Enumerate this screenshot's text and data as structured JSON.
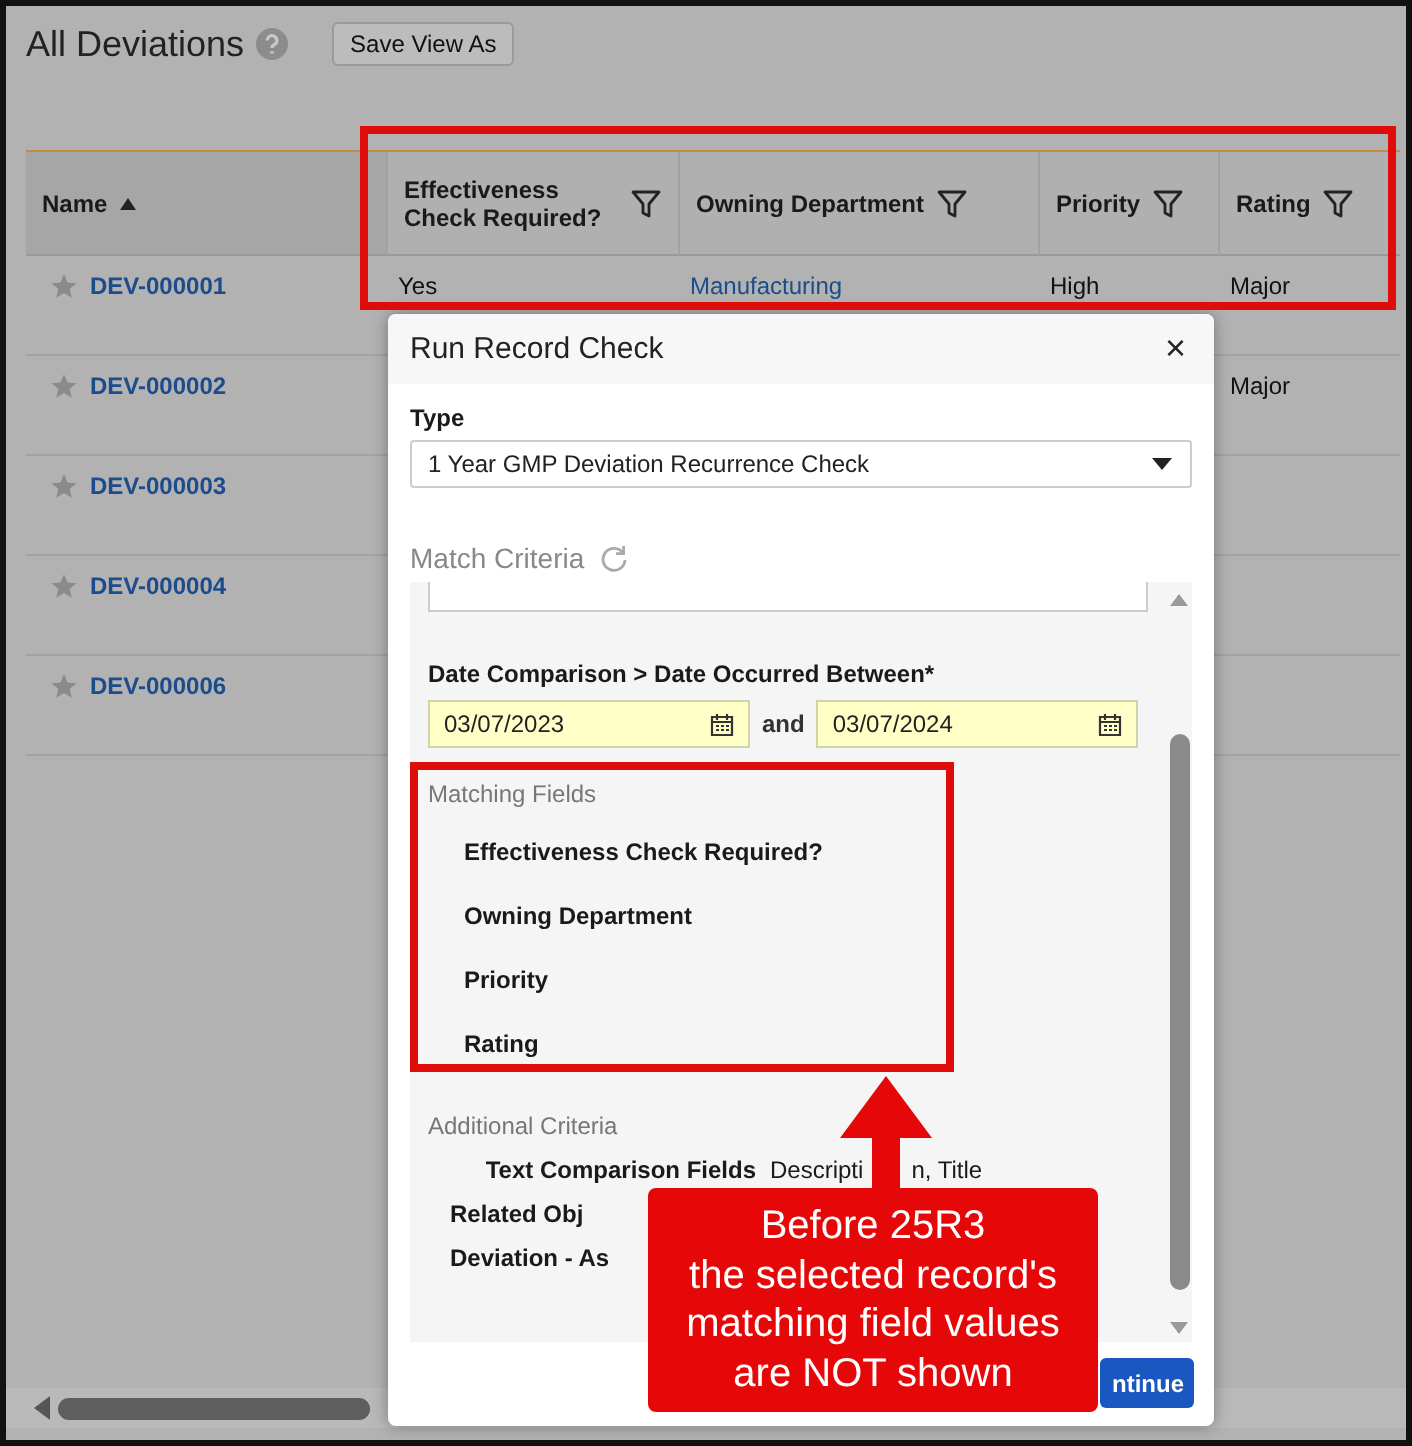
{
  "page": {
    "title": "All Deviations",
    "save_view_button": "Save View As"
  },
  "table": {
    "columns": [
      {
        "label": "Name",
        "sorted": true,
        "filter": false,
        "link": true
      },
      {
        "label": "Effectiveness Check Required?",
        "sorted": false,
        "filter": true,
        "link": false
      },
      {
        "label": "Owning Department",
        "sorted": false,
        "filter": true,
        "link": true
      },
      {
        "label": "Priority",
        "sorted": false,
        "filter": true,
        "link": false
      },
      {
        "label": "Rating",
        "sorted": false,
        "filter": true,
        "link": false
      }
    ],
    "rows": [
      {
        "name": "DEV-000001",
        "effectiveness_check_required": "Yes",
        "owning_department": "Manufacturing",
        "priority": "High",
        "rating": "Major"
      },
      {
        "name": "DEV-000002",
        "rating": "Major"
      },
      {
        "name": "DEV-000003"
      },
      {
        "name": "DEV-000004"
      },
      {
        "name": "DEV-000006"
      }
    ]
  },
  "dialog": {
    "title": "Run Record Check",
    "close": "×",
    "type_label": "Type",
    "type_value": "1 Year GMP Deviation Recurrence Check",
    "match_criteria_label": "Match Criteria",
    "date_label": "Date Comparison > Date Occurred Between*",
    "date_from": "03/07/2023",
    "date_joiner": "and",
    "date_to": "03/07/2024",
    "matching_fields_label": "Matching Fields",
    "matching_fields": [
      "Effectiveness Check Required?",
      "Owning Department",
      "Priority",
      "Rating"
    ],
    "additional_criteria_label": "Additional Criteria",
    "additional_criteria": [
      {
        "kind": "full",
        "label": "Text Comparison Fields",
        "value_parts": [
          "Descripti",
          "n, Title"
        ]
      },
      {
        "kind": "cut",
        "label": "Related Obj"
      },
      {
        "kind": "cut",
        "label": "Deviation - As"
      }
    ],
    "continue_button": "ntinue"
  },
  "annotation": {
    "callout_lines": [
      "Before 25R3",
      "the selected record's",
      "matching field values",
      "are NOT shown"
    ]
  }
}
